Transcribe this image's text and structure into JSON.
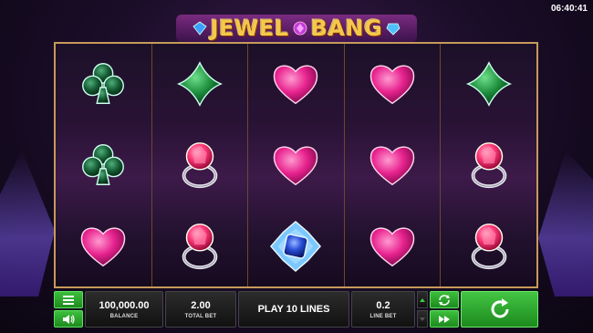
{
  "header": {
    "clock": "06:40:41",
    "logo_text_1": "JEWEL",
    "logo_text_2": "BANG"
  },
  "reels": [
    [
      "club-icon",
      "club-icon",
      "heart-icon"
    ],
    [
      "diamond-suit-icon",
      "ruby-ring-icon",
      "ruby-ring-icon"
    ],
    [
      "heart-icon",
      "heart-icon",
      "sapphire-brooch-icon"
    ],
    [
      "heart-icon",
      "heart-icon",
      "heart-icon"
    ],
    [
      "diamond-suit-icon",
      "ruby-ring-icon",
      "ruby-ring-icon"
    ]
  ],
  "controls": {
    "balance_value": "100,000.00",
    "balance_label": "BALANCE",
    "total_bet_value": "2.00",
    "total_bet_label": "TOTAL BET",
    "lines_text": "PLAY 10 LINES",
    "line_bet_value": "0.2",
    "line_bet_label": "LINE BET"
  },
  "colors": {
    "frame": "#c69a5a",
    "button_green": "#2fae2f",
    "heart_pink": "#e8238f",
    "suit_green": "#1a8a3a",
    "gem_blue": "#2a4fd8"
  }
}
